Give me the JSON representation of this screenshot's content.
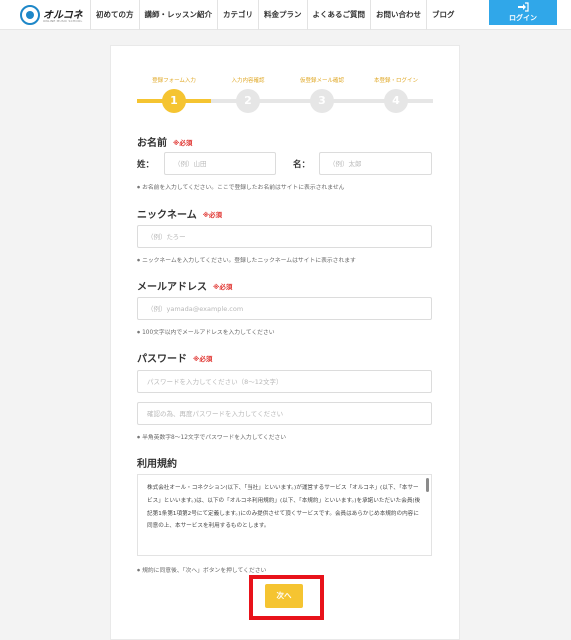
{
  "header": {
    "logo_text": "オルコネ",
    "logo_sub": "ONLINE MUSIC SCHOOL",
    "nav": [
      "初めての方",
      "講師・レッスン紹介",
      "カテゴリ",
      "料金プラン",
      "よくあるご質問",
      "お問い合わせ",
      "ブログ"
    ],
    "login_label": "ログイン",
    "login_icon": "login-icon"
  },
  "steps": [
    {
      "label": "登録フォーム入力",
      "number": "1",
      "active": true
    },
    {
      "label": "入力内容確認",
      "number": "2",
      "active": false
    },
    {
      "label": "仮登録メール確認",
      "number": "3",
      "active": false
    },
    {
      "label": "本登録・ログイン",
      "number": "4",
      "active": false
    }
  ],
  "name_section": {
    "title": "お名前",
    "required": "※必須",
    "last_label": "姓：",
    "last_placeholder": "（例）山田",
    "first_label": "名：",
    "first_placeholder": "（例）太郎",
    "hint": "お名前を入力してください。ここで登録したお名前はサイトに表示されません"
  },
  "nickname_section": {
    "title": "ニックネーム",
    "required": "※必須",
    "placeholder": "（例）たろー",
    "hint": "ニックネームを入力してください。登録したニックネームはサイトに表示されます"
  },
  "email_section": {
    "title": "メールアドレス",
    "required": "※必須",
    "placeholder": "（例）yamada@example.com",
    "hint": "100文字以内でメールアドレスを入力してください"
  },
  "password_section": {
    "title": "パスワード",
    "required": "※必須",
    "placeholder": "パスワードを入力してください（8〜12文字）",
    "confirm_placeholder": "確認の為、再度パスワードを入力してください",
    "hint": "半角英数字8〜12文字でパスワードを入力してください"
  },
  "terms_section": {
    "title": "利用規約",
    "text": "株式会社オール・コネクション(以下、「当社」といいます。)が運営するサービス「オルコネ」(以下、「本サービス」といいます。)は、以下の「オルコネ利用規約」(以下、「本規約」といいます。)を承諾いただいた会員(後記第1条第1項第2号にて定義します。)にのみ提供させて頂くサービスです。会員はあらかじめ本規約の内容に同意の上、本サービスを利用するものとします。",
    "hint": "規約に同意後、「次へ」ボタンを押してください"
  },
  "next_button": "次へ",
  "colors": {
    "accent": "#f5c431",
    "login_blue": "#30a7e9",
    "required_red": "#e0332f",
    "highlight_red": "#e8121a"
  }
}
